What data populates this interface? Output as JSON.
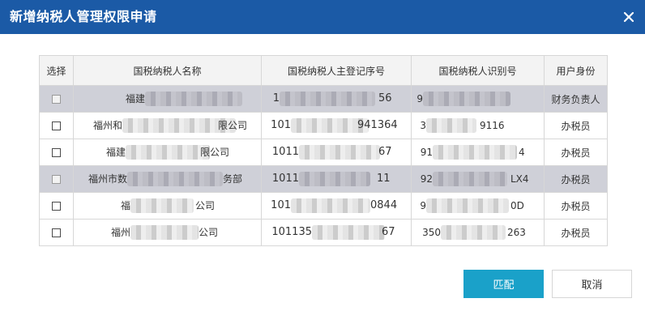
{
  "dialog": {
    "title": "新增纳税人管理权限申请",
    "close_icon": "close-icon"
  },
  "table": {
    "headers": [
      "选择",
      "国税纳税人名称",
      "国税纳税人主登记序号",
      "国税纳税人识别号",
      "用户身份"
    ],
    "rows": [
      {
        "disabled": true,
        "name": "福建",
        "name_tail": "",
        "reg": "1",
        "reg_tail": "56",
        "tax": "9",
        "tax_tail": "",
        "role": "财务负责人"
      },
      {
        "disabled": false,
        "name": "福州和",
        "name_tail": "限公司",
        "reg": "101",
        "reg_tail": "941364",
        "tax": "3",
        "tax_tail": "9116",
        "role": "办税员"
      },
      {
        "disabled": false,
        "name": "福建",
        "name_tail": "限公司",
        "reg": "1011",
        "reg_tail": "67",
        "tax": "91",
        "tax_tail": "4",
        "role": "办税员"
      },
      {
        "disabled": true,
        "name": "福州市数",
        "name_tail": "务部",
        "reg": "1011",
        "reg_tail": "11",
        "tax": "92",
        "tax_tail": "LX4",
        "role": "办税员"
      },
      {
        "disabled": false,
        "name": "福",
        "name_tail": "公司",
        "reg": "101",
        "reg_tail": "0844",
        "tax": "9",
        "tax_tail": "0D",
        "role": "办税员"
      },
      {
        "disabled": false,
        "name": "福州",
        "name_tail": "公司",
        "reg": "101135",
        "reg_tail": "67",
        "tax": "350",
        "tax_tail": "263",
        "role": "办税员"
      }
    ]
  },
  "buttons": {
    "match": "匹配",
    "cancel": "取消"
  },
  "colors": {
    "title_bar": "#1b5aa6",
    "primary_button": "#1aa1c9",
    "disabled_row": "#cfd0d8"
  }
}
